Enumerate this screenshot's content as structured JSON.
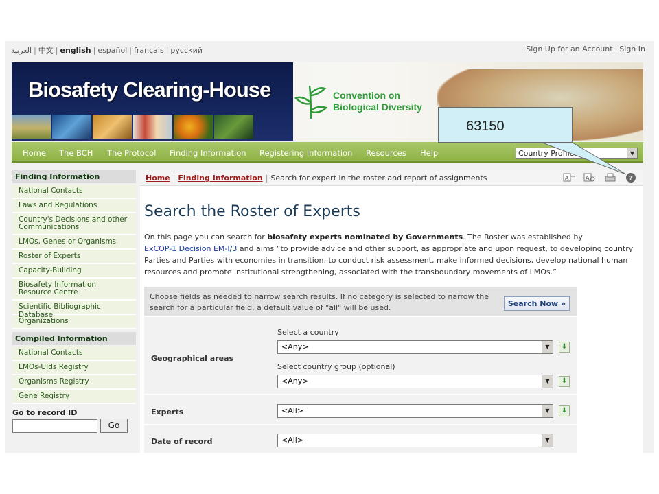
{
  "languages": [
    {
      "label": "العربية",
      "active": false
    },
    {
      "label": "中文",
      "active": false
    },
    {
      "label": "english",
      "active": true
    },
    {
      "label": "español",
      "active": false
    },
    {
      "label": "français",
      "active": false
    },
    {
      "label": "русский",
      "active": false
    }
  ],
  "account": {
    "signup": "Sign Up for an Account",
    "signin": "Sign In"
  },
  "banner": {
    "title": "Biosafety Clearing-House",
    "cbd_line1": "Convention on",
    "cbd_line2": "Biological Diversity"
  },
  "nav": {
    "items": [
      "Home",
      "The BCH",
      "The Protocol",
      "Finding Information",
      "Registering Information",
      "Resources",
      "Help"
    ],
    "country_select": "Country Profiles..."
  },
  "callout": {
    "text": "63150"
  },
  "sidebar": {
    "finding_header": "Finding Information",
    "finding_items": [
      "National Contacts",
      "Laws and Regulations",
      "Country's Decisions and other Communications",
      "LMOs, Genes or Organisms",
      "Roster of Experts",
      "Capacity-Building",
      "Biosafety Information Resource Centre",
      "Scientific Bibliographic Database",
      "Organizations"
    ],
    "compiled_header": "Compiled Information",
    "compiled_items": [
      "National Contacts",
      "LMOs-UIds Registry",
      "Organisms Registry",
      "Gene Registry"
    ],
    "goto_label": "Go to record ID",
    "goto_button": "Go"
  },
  "breadcrumb": {
    "home": "Home",
    "finding": "Finding Information",
    "current": "Search for expert in the roster and report of assignments"
  },
  "page": {
    "title": "Search the Roster of Experts",
    "intro_1": "On this page you can search for ",
    "intro_bold": "biosafety experts nominated by Governments",
    "intro_2": ". The Roster was established by",
    "intro_link": "ExCOP-1 Decision EM-I/3",
    "intro_3": " and aims “to provide advice and other support, as appropriate and upon request, to developing country Parties and Parties with economies in transition, to conduct risk assessment, make informed decisions, develop national human resources and promote institutional strengthening, associated with the transboundary movements of LMOs.”"
  },
  "search": {
    "hint": "Choose fields as needed to narrow search results. If no category is selected to narrow the search for a particular field, a default value of \"all\" will be used.",
    "button": "Search Now »",
    "geo_label": "Geographical areas",
    "country_caption": "Select a country",
    "country_value": "<Any>",
    "group_caption": "Select country group (optional)",
    "group_value": "<Any>",
    "experts_label": "Experts",
    "experts_value": "<All>",
    "date_label": "Date of record",
    "date_value": "<All>"
  }
}
